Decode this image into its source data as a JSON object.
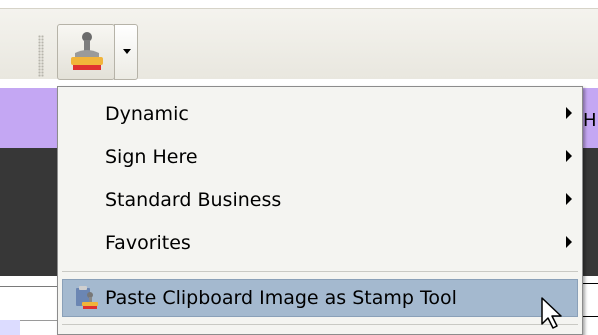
{
  "menu": {
    "items": [
      {
        "label": "Dynamic",
        "submenu": true
      },
      {
        "label": "Sign Here",
        "submenu": true
      },
      {
        "label": "Standard Business",
        "submenu": true
      },
      {
        "label": "Favorites",
        "submenu": true
      }
    ],
    "paste_label": "Paste Clipboard Image as Stamp Tool"
  },
  "background": {
    "edge_letter": "H"
  },
  "icons": {
    "stamp": "stamp-icon",
    "dropdown": "chevron-down-icon",
    "paste": "paste-stamp-icon",
    "cursor": "mouse-cursor-icon"
  },
  "colors": {
    "highlight": "#a4b9cf",
    "purple_bar": "#c4a7f3",
    "dark_bar": "#373737"
  }
}
